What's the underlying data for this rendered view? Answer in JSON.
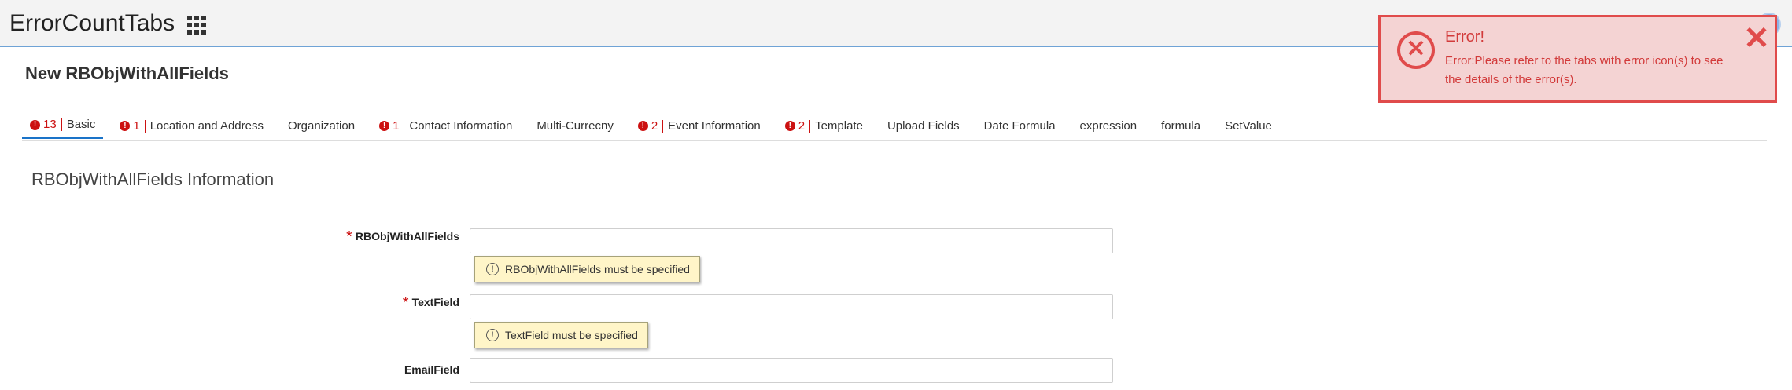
{
  "header": {
    "app_title": "ErrorCountTabs",
    "apps_icon": "grid-icon",
    "avatar_icon": "user-avatar"
  },
  "page": {
    "title": "New RBObjWithAllFields"
  },
  "tabs": [
    {
      "label": "Basic",
      "error_count": "13",
      "active": true
    },
    {
      "label": "Location and Address",
      "error_count": "1"
    },
    {
      "label": "Organization",
      "error_count": ""
    },
    {
      "label": "Contact Information",
      "error_count": "1"
    },
    {
      "label": "Multi-Currecny",
      "error_count": ""
    },
    {
      "label": "Event Information",
      "error_count": "2"
    },
    {
      "label": "Template",
      "error_count": "2"
    },
    {
      "label": "Upload Fields",
      "error_count": ""
    },
    {
      "label": "Date Formula",
      "error_count": ""
    },
    {
      "label": "expression",
      "error_count": ""
    },
    {
      "label": "formula",
      "error_count": ""
    },
    {
      "label": "SetValue",
      "error_count": ""
    }
  ],
  "section": {
    "title": "RBObjWithAllFields Information"
  },
  "fields": [
    {
      "label": "RBObjWithAllFields",
      "required": "*",
      "value": "",
      "error": "RBObjWithAllFields must be specified"
    },
    {
      "label": "TextField",
      "required": "*",
      "value": "",
      "error": "TextField must be specified"
    },
    {
      "label": "EmailField",
      "required": "",
      "value": "",
      "error": ""
    }
  ],
  "toast": {
    "title": "Error!",
    "message": "Error:Please refer to the tabs with error icon(s) to see the details of the error(s).",
    "icon": "error-circle-icon",
    "close_icon": "close-icon",
    "color": "#e04b4b",
    "background": "#f4d3d3"
  },
  "colors": {
    "error_red": "#cc1111",
    "active_tab": "#1a73c8",
    "tooltip_bg": "#fff5c8"
  }
}
